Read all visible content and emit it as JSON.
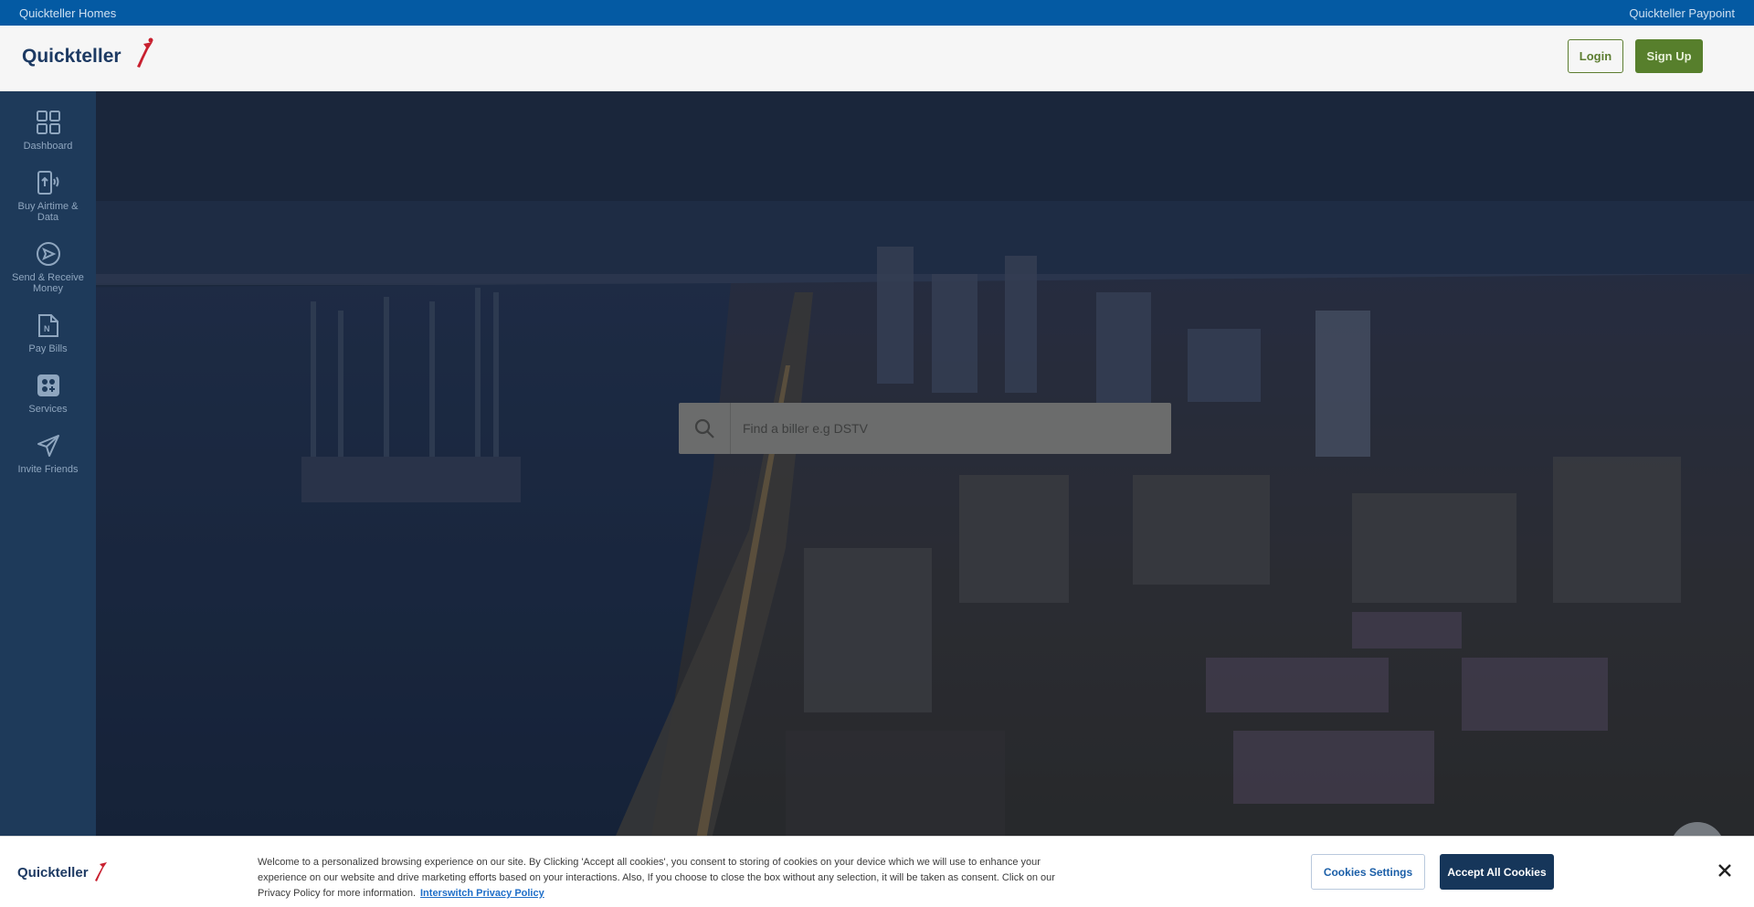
{
  "topbar": {
    "left_link": "Quickteller Homes",
    "right_link": "Quickteller Paypoint"
  },
  "header": {
    "logo_text": "Quickteller",
    "login_label": "Login",
    "signup_label": "Sign Up"
  },
  "sidebar": {
    "items": [
      {
        "label": "Dashboard",
        "icon": "grid-icon"
      },
      {
        "label": "Buy Airtime & Data",
        "icon": "phone-airtime-icon"
      },
      {
        "label": "Send & Receive Money",
        "icon": "send-circle-icon"
      },
      {
        "label": "Pay Bills",
        "icon": "bill-icon"
      },
      {
        "label": "Services",
        "icon": "services-icon"
      },
      {
        "label": "Invite Friends",
        "icon": "paper-plane-icon"
      }
    ]
  },
  "search": {
    "placeholder": "Find a biller e.g DSTV",
    "icon": "search-icon"
  },
  "cookie_banner": {
    "logo_text": "Quickteller",
    "text": "Welcome to a personalized browsing experience on our site. By Clicking 'Accept all cookies', you consent to storing of cookies on your device which we will use to enhance your experience on our website and drive marketing efforts based on your interactions. Also, If you choose to close the box without any selection, it will be taken as consent. Click on our Privacy Policy for more information.",
    "policy_link": "Interswitch Privacy Policy",
    "settings_label": "Cookies Settings",
    "accept_label": "Accept All Cookies",
    "close_icon": "close-icon"
  },
  "colors": {
    "topbar": "#045aa3",
    "sidebar": "#1e3a5a",
    "accent_green": "#577f2c",
    "brand_red": "#c8202f",
    "brand_blue": "#1d3a63"
  }
}
